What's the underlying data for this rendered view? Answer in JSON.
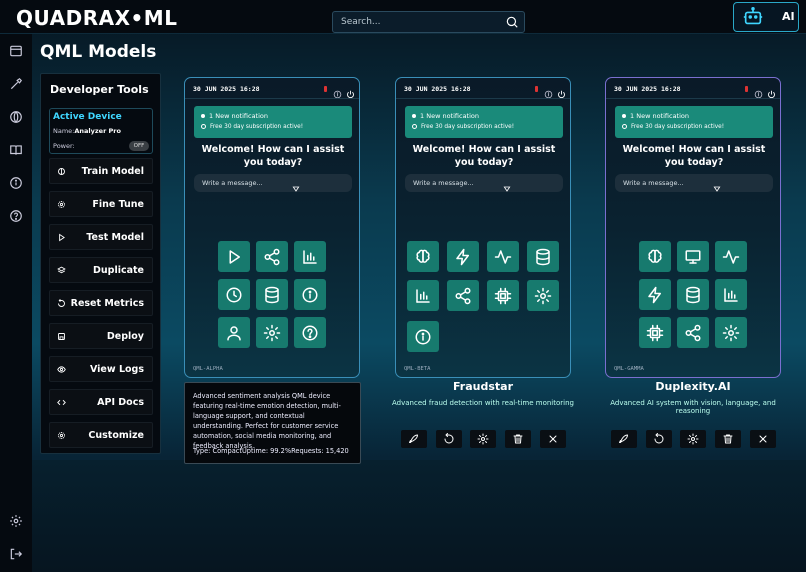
{
  "app": {
    "title": "QUADRAX•ML"
  },
  "search": {
    "placeholder": "Search..."
  },
  "assistant": {
    "label": "AI",
    "icon": "robot-icon"
  },
  "rail": {
    "top_icons": [
      "window-icon",
      "tools-icon",
      "globe-icon",
      "book-icon",
      "info-icon",
      "help-icon"
    ],
    "bottom_icons": [
      "gear-icon",
      "logout-icon"
    ]
  },
  "page": {
    "title": "QML Models"
  },
  "dev_tools": {
    "title": "Developer Tools",
    "active_device": {
      "title": "Active Device",
      "name_label": "Name:",
      "name_value": "Analyzer Pro",
      "power_label": "Power:",
      "power_state": "OFF"
    },
    "buttons": [
      {
        "label": "Train Model",
        "icon": "brain-icon"
      },
      {
        "label": "Fine Tune",
        "icon": "gear-icon"
      },
      {
        "label": "Test Model",
        "icon": "play-icon"
      },
      {
        "label": "Duplicate",
        "icon": "layers-icon"
      },
      {
        "label": "Reset Metrics",
        "icon": "reset-icon"
      },
      {
        "label": "Deploy",
        "icon": "save-icon"
      },
      {
        "label": "View Logs",
        "icon": "eye-icon"
      },
      {
        "label": "API Docs",
        "icon": "code-icon"
      },
      {
        "label": "Customize",
        "icon": "gear-icon"
      }
    ]
  },
  "cards": [
    {
      "time": "30 JUN 2025 16:28",
      "notif_title": "1 New notification",
      "notif_sub": "Free 30 day subscription active!",
      "welcome": "Welcome! How can I assist you today?",
      "message_placeholder": "Write a message...",
      "code": "QML-ALPHA",
      "name": "",
      "description": "",
      "icons": [
        "play-icon",
        "share-icon",
        "chart-icon",
        "clock-icon",
        "database-icon",
        "info-icon",
        "user-icon",
        "gear-icon",
        "help-icon"
      ]
    },
    {
      "time": "30 JUN 2025 16:28",
      "notif_title": "1 New notification",
      "notif_sub": "Free 30 day subscription active!",
      "welcome": "Welcome! How can I assist you today?",
      "message_placeholder": "Write a message...",
      "code": "QML-BETA",
      "name": "Fraudstar",
      "description": "Advanced fraud detection with real-time monitoring",
      "icons": [
        "brain-icon",
        "bolt-icon",
        "activity-icon",
        "database-icon",
        "chart-icon",
        "share-icon",
        "cpu-icon",
        "gear-icon",
        "info-icon"
      ]
    },
    {
      "time": "30 JUN 2025 16:28",
      "notif_title": "1 New notification",
      "notif_sub": "Free 30 day subscription active!",
      "welcome": "Welcome! How can I assist you today?",
      "message_placeholder": "Write a message...",
      "code": "QML-GAMMA",
      "name": "Duplexity.AI",
      "description": "Advanced AI system with vision, language, and reasoning",
      "icons": [
        "brain-icon",
        "monitor-icon",
        "activity-icon",
        "bolt-icon",
        "database-icon",
        "chart-icon",
        "cpu-icon",
        "share-icon",
        "gear-icon"
      ]
    }
  ],
  "card_actions": [
    "rocket-icon",
    "reset-icon",
    "gear-icon",
    "trash-icon",
    "close-icon"
  ],
  "tooltip": {
    "description": "Advanced sentiment analysis QML device featuring real-time emotion detection, multi-language support, and contextual understanding. Perfect for customer service automation, social media monitoring, and feedback analysis.",
    "stats": "Type: CompactUptime: 99.2%Requests: 15,420"
  },
  "colors": {
    "accent": "#3fd6ff",
    "tile": "#177a6e",
    "notification": "#1a8a7a",
    "gamma_border": "#7a6fd0"
  }
}
